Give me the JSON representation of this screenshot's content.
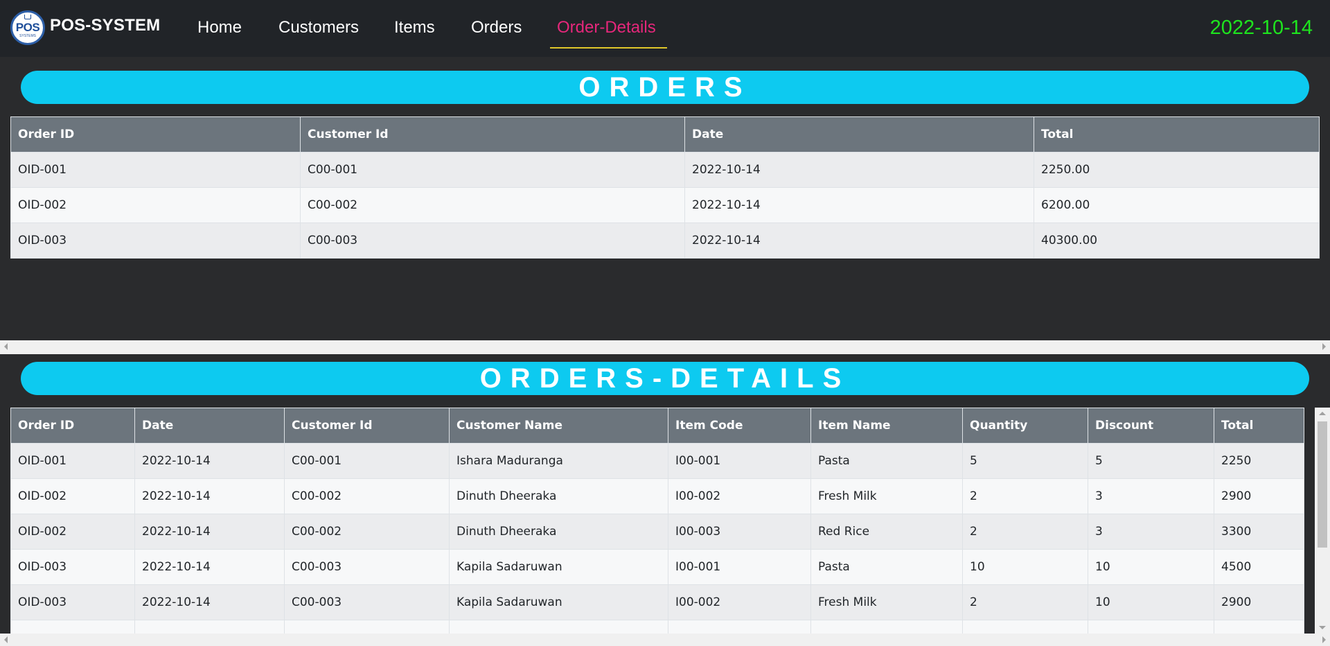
{
  "navbar": {
    "logo_text": "POS",
    "logo_subtext": "SYSTEMS",
    "brand": "POS-SYSTEM",
    "links": [
      "Home",
      "Customers",
      "Items",
      "Orders",
      "Order-Details"
    ],
    "active_link": "Order-Details",
    "date": "2022-10-14"
  },
  "orders": {
    "title": "ORDERS",
    "columns": [
      "Order ID",
      "Customer Id",
      "Date",
      "Total"
    ],
    "rows": [
      [
        "OID-001",
        "C00-001",
        "2022-10-14",
        "2250.00"
      ],
      [
        "OID-002",
        "C00-002",
        "2022-10-14",
        "6200.00"
      ],
      [
        "OID-003",
        "C00-003",
        "2022-10-14",
        "40300.00"
      ]
    ]
  },
  "order_details": {
    "title": "ORDERS-DETAILS",
    "columns": [
      "Order ID",
      "Date",
      "Customer Id",
      "Customer Name",
      "Item Code",
      "Item Name",
      "Quantity",
      "Discount",
      "Total"
    ],
    "rows": [
      [
        "OID-001",
        "2022-10-14",
        "C00-001",
        "Ishara Maduranga",
        "I00-001",
        "Pasta",
        "5",
        "5",
        "2250"
      ],
      [
        "OID-002",
        "2022-10-14",
        "C00-002",
        "Dinuth Dheeraka",
        "I00-002",
        "Fresh Milk",
        "2",
        "3",
        "2900"
      ],
      [
        "OID-002",
        "2022-10-14",
        "C00-002",
        "Dinuth Dheeraka",
        "I00-003",
        "Red Rice",
        "2",
        "3",
        "3300"
      ],
      [
        "OID-003",
        "2022-10-14",
        "C00-003",
        "Kapila Sadaruwan",
        "I00-001",
        "Pasta",
        "10",
        "10",
        "4500"
      ],
      [
        "OID-003",
        "2022-10-14",
        "C00-003",
        "Kapila Sadaruwan",
        "I00-002",
        "Fresh Milk",
        "2",
        "10",
        "2900"
      ]
    ]
  },
  "colors": {
    "accent": "#0dcaf0",
    "active_nav": "#e6277b",
    "date": "#1ee41e",
    "header_bg": "#6c757d"
  }
}
